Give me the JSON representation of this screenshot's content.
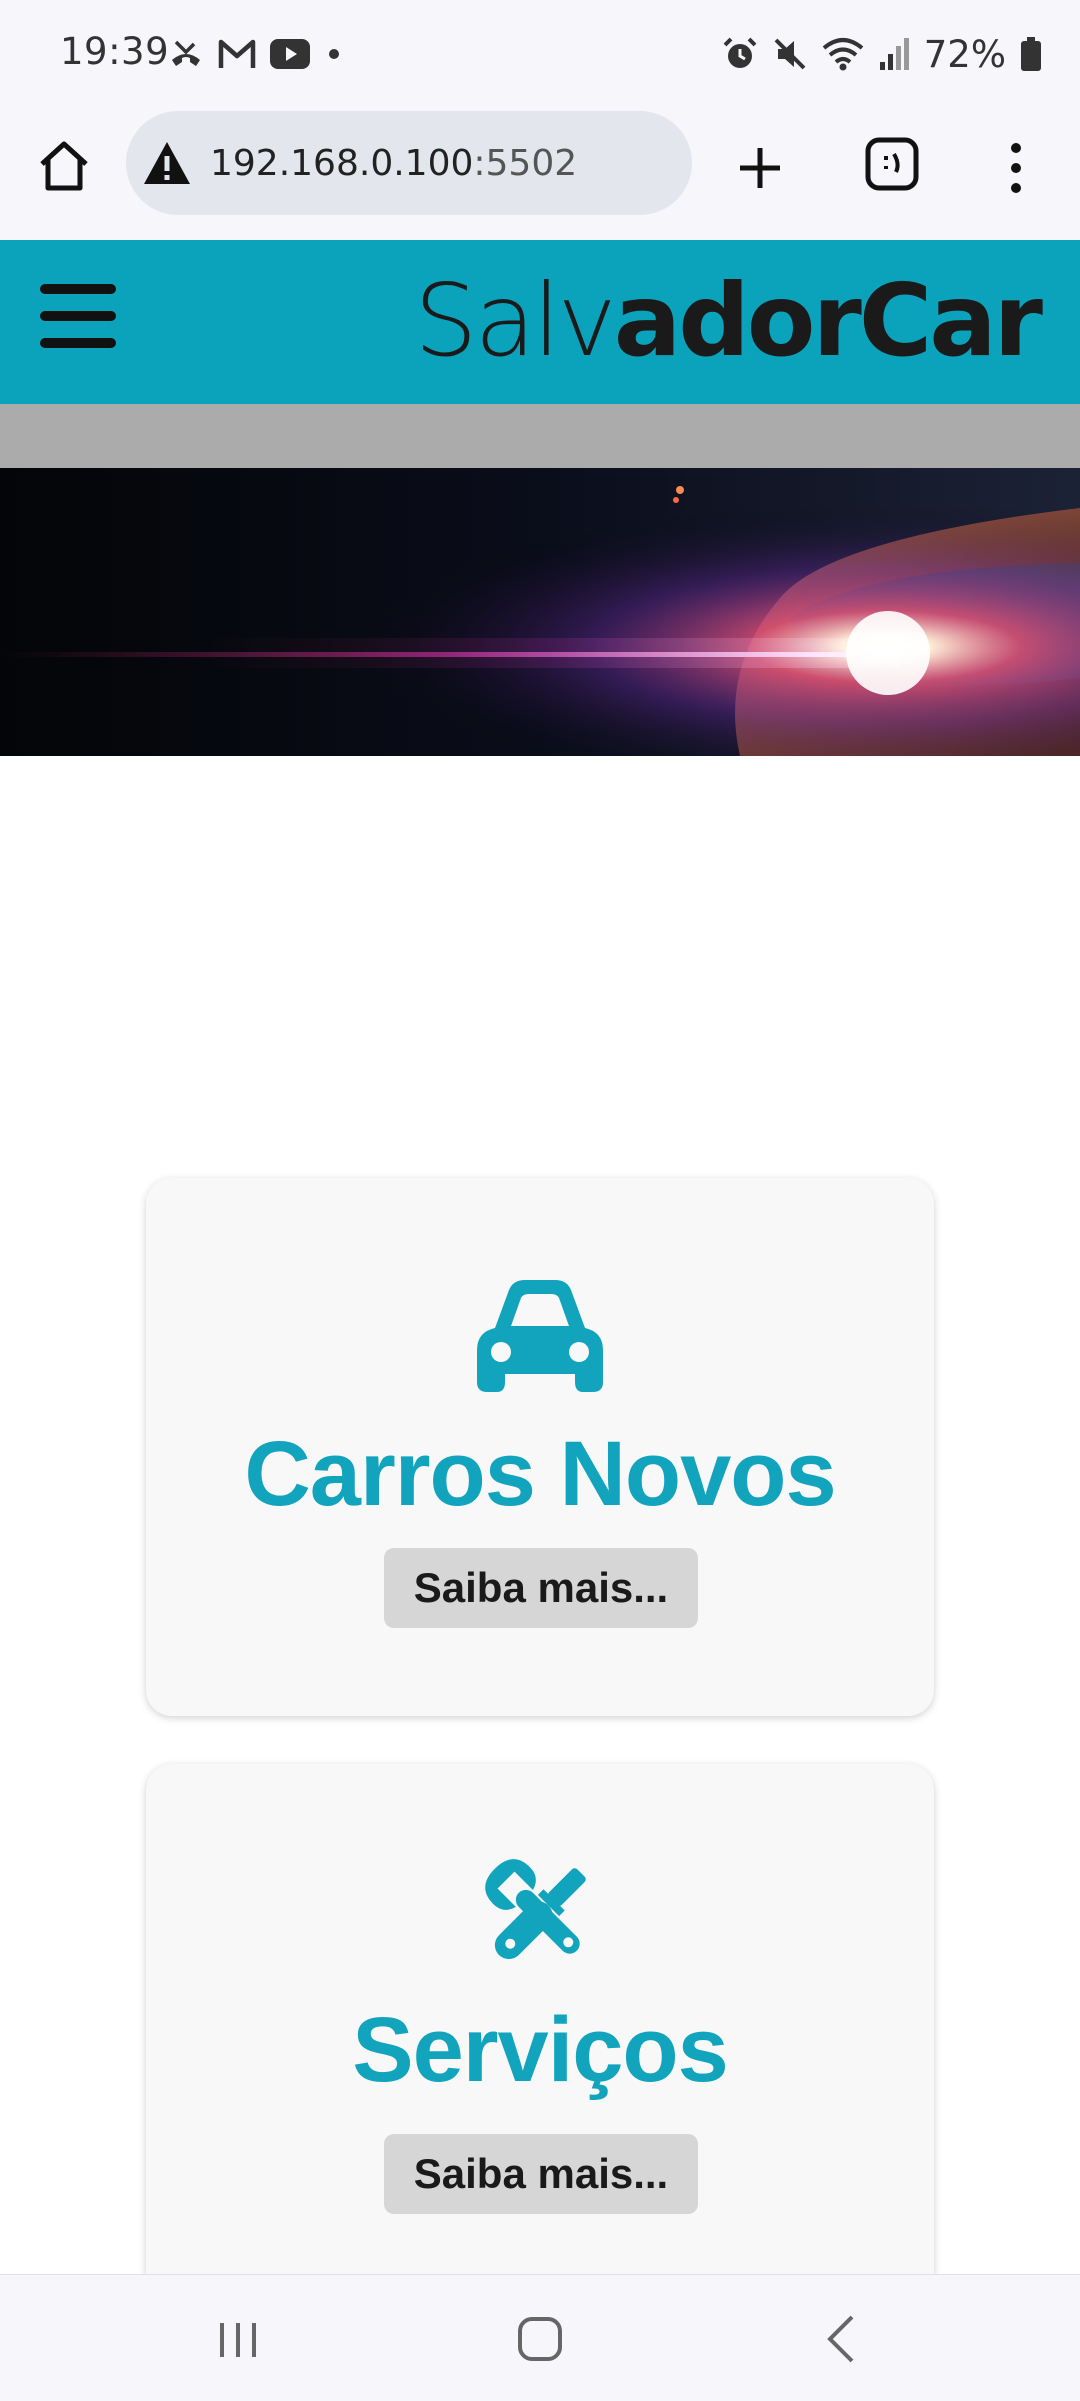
{
  "status_bar": {
    "time": "19:39",
    "battery": "72%",
    "left_icons": [
      "missed-call-icon",
      "gmail-icon",
      "youtube-icon",
      "dot-icon"
    ],
    "right_icons": [
      "alarm-icon",
      "mute-icon",
      "wifi-icon",
      "signal-icon",
      "battery-icon"
    ]
  },
  "browser": {
    "url_host": "192.168.0.100",
    "url_port": ":5502",
    "buttons": [
      "home-icon",
      "new-tab-icon",
      "tabs-icon",
      "menu-icon"
    ]
  },
  "header": {
    "brand_light": "Salv",
    "brand_mid": "ador",
    "brand_bold": "Car"
  },
  "cards": [
    {
      "title": "Carros Novos",
      "button": "Saiba mais...",
      "icon": "car-icon"
    },
    {
      "title": "Serviços",
      "button": "Saiba mais...",
      "icon": "tools-icon"
    }
  ],
  "colors": {
    "accent": "#0aa3bb",
    "card_title": "#13a4bd",
    "header_strip": "#ababab"
  }
}
